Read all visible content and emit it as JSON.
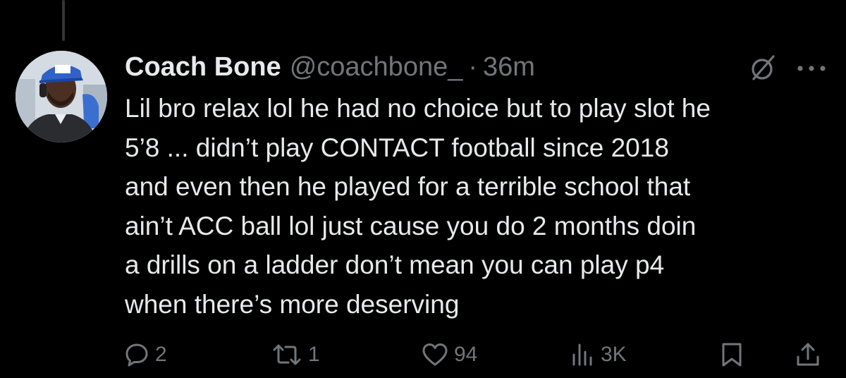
{
  "tweet": {
    "display_name": "Coach Bone",
    "handle": "@coachbone_",
    "separator": "·",
    "time": "36m",
    "text": "Lil bro relax lol he had no choice but to play slot he\n5’8 ... didn’t play CONTACT football since 2018\nand even then he played for a terrible school that\nain’t ACC ball lol just cause you do 2 months doin\na drills on a ladder don’t mean you can play p4\nwhen there’s more deserving"
  },
  "actions": {
    "replies": "2",
    "reposts": "1",
    "likes": "94",
    "views": "3K"
  },
  "icons": {
    "grok": "grok-icon",
    "more": "more-icon",
    "reply": "reply-icon",
    "repost": "repost-icon",
    "like": "heart-icon",
    "views": "views-icon",
    "bookmark": "bookmark-icon",
    "share": "share-icon"
  },
  "colors": {
    "background": "#000000",
    "primary_text": "#e7e9ea",
    "secondary_text": "#71767b",
    "thread_line": "#333639"
  }
}
